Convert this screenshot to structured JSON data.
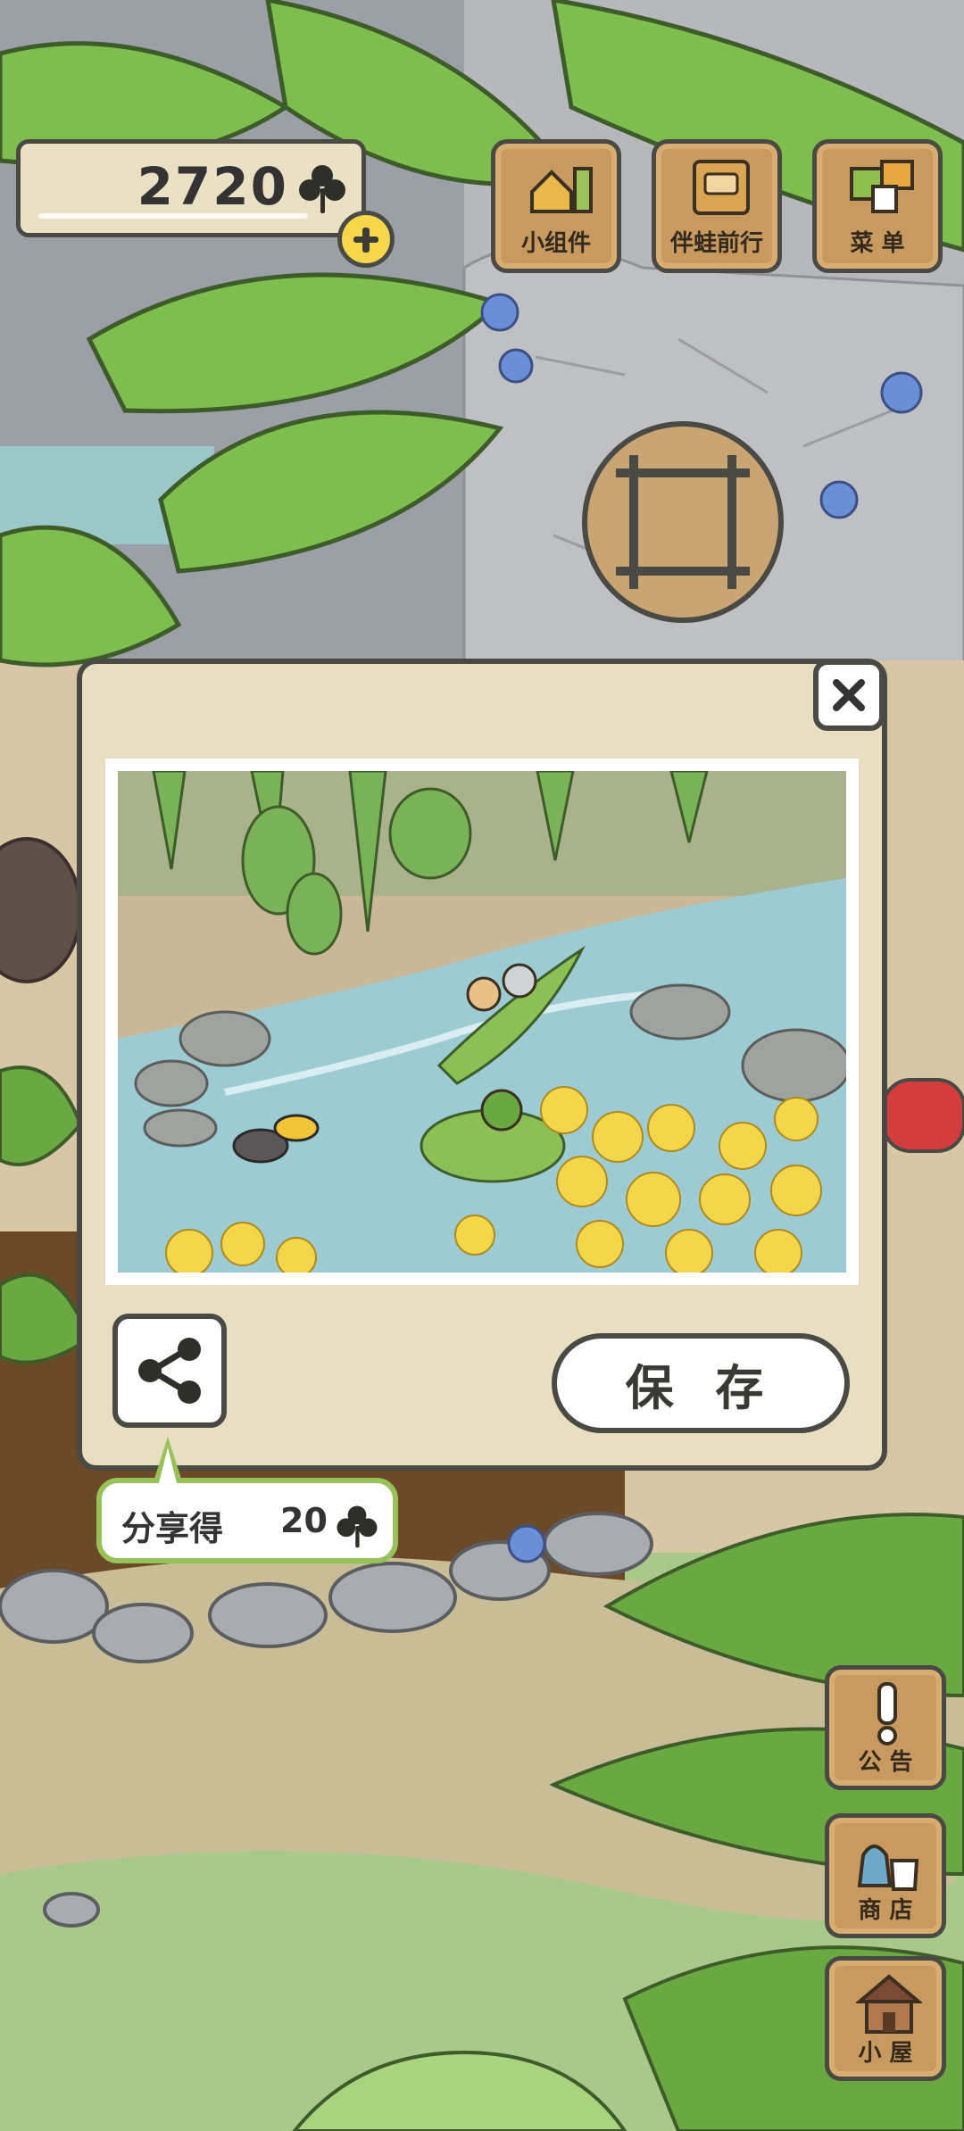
{
  "clovers": {
    "count": "2720",
    "icon": "clover-icon"
  },
  "top_menu": [
    {
      "label": "小组件",
      "icon": "widget-icon"
    },
    {
      "label": "伴蛙前行",
      "icon": "journal-icon"
    },
    {
      "label": "菜 单",
      "icon": "menu-icon"
    }
  ],
  "side_menu": [
    {
      "label": "公 告",
      "icon": "exclamation-icon"
    },
    {
      "label": "商 店",
      "icon": "shop-bag-icon"
    },
    {
      "label": "小 屋",
      "icon": "house-icon"
    }
  ],
  "photo_popup": {
    "save_label": "保 存",
    "share_tip_text": "分享得",
    "share_tip_amount": "20",
    "photo_subject": "frog and snail riding a leaf boat on a stream with yellow flowers"
  },
  "colors": {
    "panel": "#e8dfc3",
    "outline": "#4a4a44",
    "wood": "#c89a5f",
    "tip_border": "#98c15a",
    "coin_yellow": "#f6d64a"
  }
}
